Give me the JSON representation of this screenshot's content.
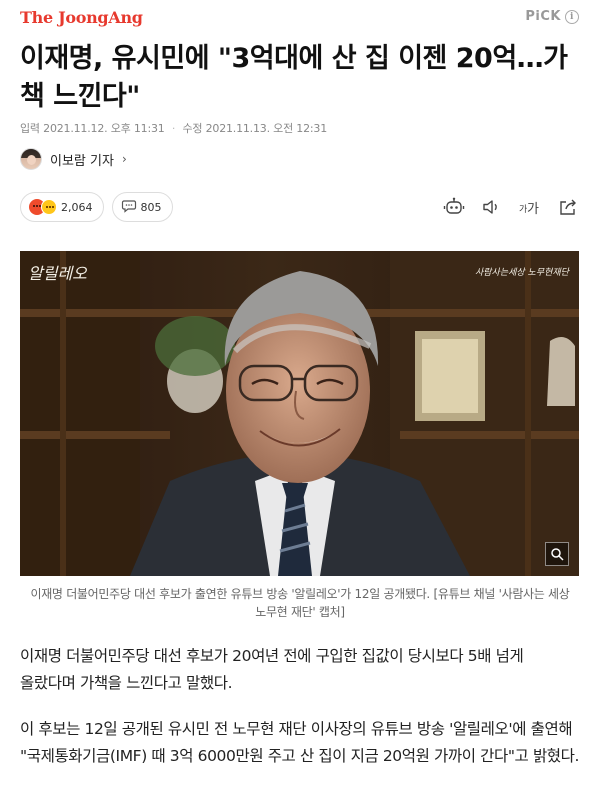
{
  "header": {
    "brand": "The JoongAng",
    "pick_label": "PiCK",
    "pick_info_icon": "i"
  },
  "article": {
    "headline": "이재명, 유시민에 \"3억대에 산 집 이젠 20억…가책 느낀다\"",
    "published_label": "입력",
    "published": "2021.11.12. 오후 11:31",
    "updated_label": "수정",
    "updated": "2021.11.13. 오전 12:31",
    "reporter": "이보람 기자",
    "reporter_chevron": "›",
    "reactions_count": "2,064",
    "comments_count": "805",
    "font_size_label": "가",
    "photo": {
      "overlay_left": "알릴레오",
      "overlay_right": "사람사는세상 노무현재단"
    },
    "caption": "이재명 더불어민주당 대선 후보가 출연한 유튜브 방송 '알릴레오'가 12일 공개됐다. [유튜브 채널 '사람사는 세상 노무현 재단' 캡처]",
    "paragraphs": [
      "이재명 더불어민주당 대선 후보가 20여년 전에 구입한 집값이 당시보다 5배 넘게 올랐다며 가책을 느낀다고 말했다.",
      "이 후보는 12일 공개된 유시민 전 노무현 재단 이사장의 유튜브 방송 '알릴레오'에 출연해 \"국제통화기금(IMF) 때 3억 6000만원 주고 산 집이 지금 20억원 가까이 간다\"고 밝혔다."
    ]
  },
  "icons": {
    "reaction": "emoji-reaction-icon",
    "comment": "comment-bubble-icon",
    "summary": "robot-summary-icon",
    "audio": "speaker-icon",
    "font": "font-size-icon",
    "share": "share-icon",
    "zoom": "zoom-in-icon"
  },
  "colors": {
    "brand": "#e7392e",
    "meta": "#888888",
    "body_text": "#222222"
  }
}
